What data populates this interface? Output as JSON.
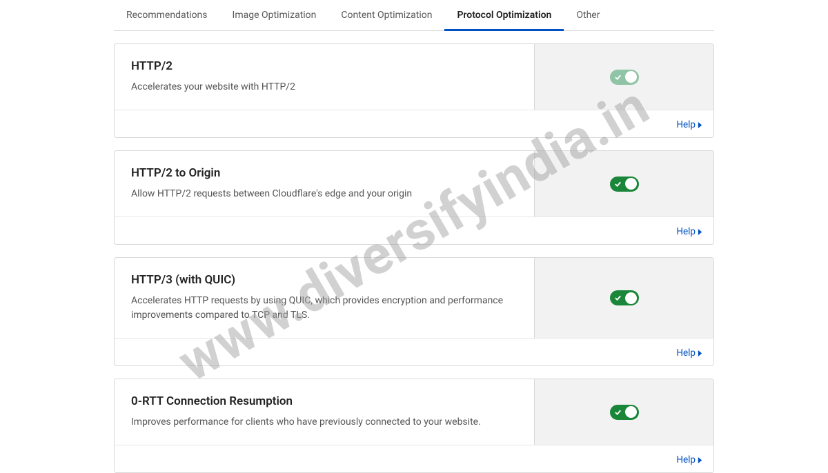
{
  "tabs": [
    {
      "label": "Recommendations",
      "active": false
    },
    {
      "label": "Image Optimization",
      "active": false
    },
    {
      "label": "Content Optimization",
      "active": false
    },
    {
      "label": "Protocol Optimization",
      "active": true
    },
    {
      "label": "Other",
      "active": false
    }
  ],
  "cards": [
    {
      "title": "HTTP/2",
      "desc": "Accelerates your website with HTTP/2",
      "toggle_on": true,
      "toggle_muted": true,
      "help": "Help"
    },
    {
      "title": "HTTP/2 to Origin",
      "desc": "Allow HTTP/2 requests between Cloudflare's edge and your origin",
      "toggle_on": true,
      "toggle_muted": false,
      "help": "Help"
    },
    {
      "title": "HTTP/3 (with QUIC)",
      "desc": "Accelerates HTTP requests by using QUIC, which provides encryption and performance improvements compared to TCP and TLS.",
      "toggle_on": true,
      "toggle_muted": false,
      "help": "Help"
    },
    {
      "title": "0-RTT Connection Resumption",
      "desc": "Improves performance for clients who have previously connected to your website.",
      "toggle_on": true,
      "toggle_muted": false,
      "help": "Help"
    }
  ],
  "watermark": "www.diversifyindia.in"
}
